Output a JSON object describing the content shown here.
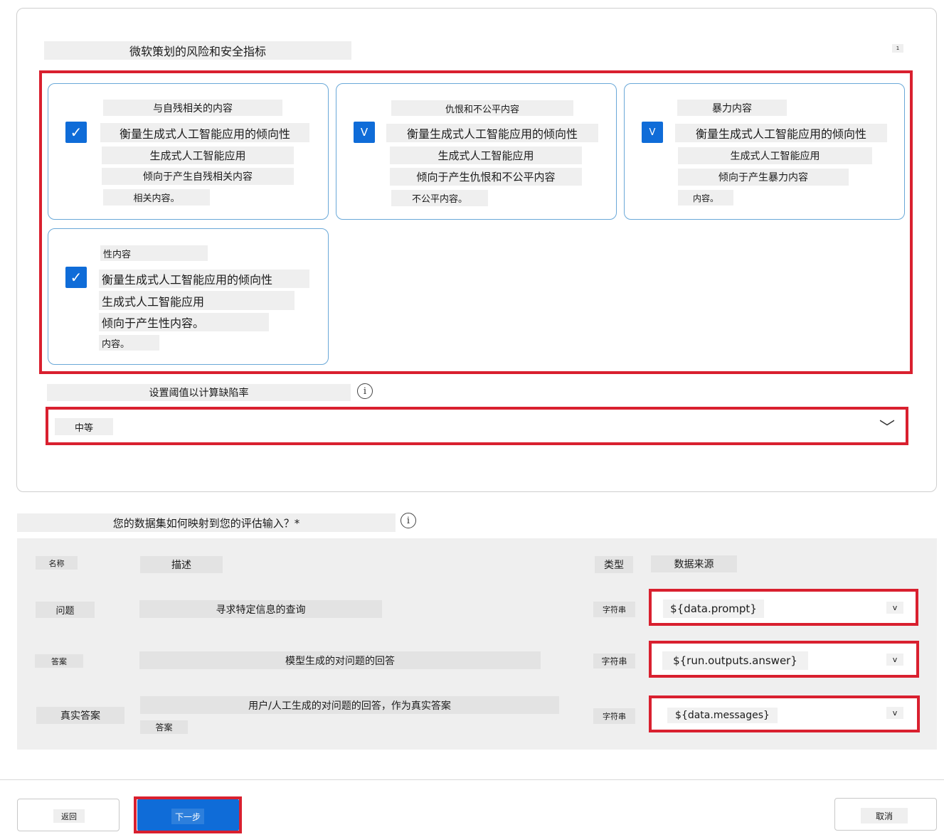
{
  "section": {
    "title": "微软策划的风险和安全指标",
    "badge": "1"
  },
  "metrics": [
    {
      "title": "与自残相关的内容",
      "lines": [
        "衡量生成式人工智能应用的倾向性",
        "生成式人工智能应用",
        "倾向于产生自残相关内容",
        "相关内容。"
      ],
      "checked": true
    },
    {
      "title": "仇恨和不公平内容",
      "lines": [
        "衡量生成式人工智能应用的倾向性",
        "生成式人工智能应用",
        "倾向于产生仇恨和不公平内容",
        "不公平内容。"
      ],
      "checked": true
    },
    {
      "title": "暴力内容",
      "lines": [
        "衡量生成式人工智能应用的倾向性",
        "生成式人工智能应用",
        "倾向于产生暴力内容",
        "内容。"
      ],
      "checked": true
    },
    {
      "title": "性内容",
      "lines": [
        "衡量生成式人工智能应用的倾向性",
        "生成式人工智能应用",
        "倾向于产生性内容。",
        "内容。"
      ],
      "checked": true
    }
  ],
  "checkbox_glyphs": {
    "check": "✓",
    "v": "V"
  },
  "threshold": {
    "label": "设置阈值以计算缺陷率",
    "info_icon": "i",
    "value": "中等",
    "chevron": "﹀"
  },
  "mapping": {
    "question": "您的数据集如何映射到您的评估输入？*",
    "info_icon": "i",
    "headers": {
      "name": "名称",
      "description": "描述",
      "type": "类型",
      "source": "数据来源"
    },
    "rows": [
      {
        "name": "问题",
        "description": "寻求特定信息的查询",
        "type": "字符串",
        "source": "${data.prompt}"
      },
      {
        "name": "答案",
        "description": "模型生成的对问题的回答",
        "type": "字符串",
        "source": "${run.outputs.answer}"
      },
      {
        "name": "真实答案",
        "description": "用户/人工生成的对问题的回答，作为真实答案",
        "description_extra": "答案",
        "type": "字符串",
        "source": "${data.messages}"
      }
    ],
    "dropdown_glyph": "v"
  },
  "footer": {
    "back": "返回",
    "next": "下一步",
    "cancel": "取消"
  },
  "colors": {
    "accent": "#0f6cd8",
    "highlight": "#d9202f",
    "card_border": "#6aa8d8"
  }
}
